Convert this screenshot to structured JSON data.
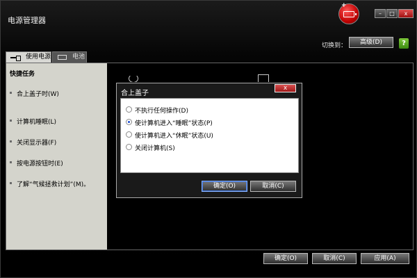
{
  "window": {
    "title": "电源管理器",
    "controls": {
      "minimize": "–",
      "maximize": "□",
      "close": "x"
    }
  },
  "header": {
    "switch_label": "切换到：",
    "advanced_button": "高级(D)",
    "help_icon": "?"
  },
  "tabs": [
    {
      "label": "使用电源",
      "icon": "plug-icon",
      "active": true
    },
    {
      "label": "电池",
      "icon": "battery-icon",
      "active": false
    }
  ],
  "sidebar": {
    "heading": "快捷任务",
    "items": [
      {
        "label": "合上盖子时(W)"
      },
      {
        "label": "计算机睡眠(L)"
      },
      {
        "label": "关闭显示器(F)"
      },
      {
        "label": "按电源按钮时(E)"
      },
      {
        "label": "了解“气候拯救计划”(M)。"
      }
    ]
  },
  "dialog": {
    "title": "合上盖子",
    "close": "x",
    "options": [
      {
        "label": "不执行任何操作(D)",
        "selected": false
      },
      {
        "label": "使计算机进入“睡眠”状态(P)",
        "selected": true
      },
      {
        "label": "使计算机进入“休眠”状态(U)",
        "selected": false
      },
      {
        "label": "关闭计算机(S)",
        "selected": false
      }
    ],
    "ok": "确定(O)",
    "cancel": "取消(C)"
  },
  "footer": {
    "ok": "确定(O)",
    "cancel": "取消(C)",
    "apply": "应用(A)"
  }
}
